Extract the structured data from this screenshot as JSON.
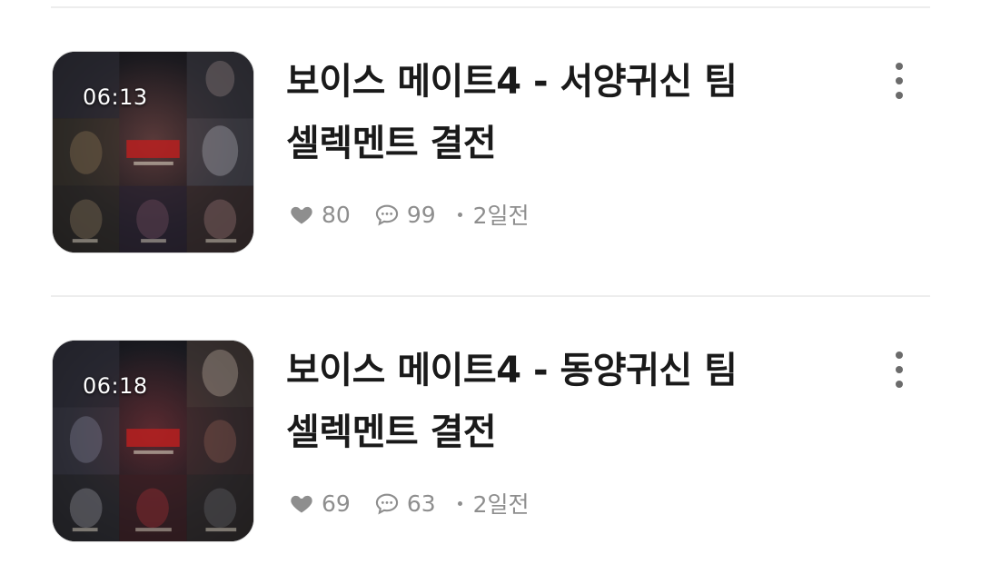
{
  "videos": [
    {
      "duration": "06:13",
      "title_line1": "보이스 메이트4 - 서양귀신 팀",
      "title_line2": "셀렉멘트 결전",
      "likes": "80",
      "comments": "99",
      "time_ago": "2일전",
      "thumbnail_icon": "video-thumbnail"
    },
    {
      "duration": "06:18",
      "title_line1": "보이스 메이트4 - 동양귀신 팀",
      "title_line2": "셀렉멘트 결전",
      "likes": "69",
      "comments": "63",
      "time_ago": "2일전",
      "thumbnail_icon": "video-thumbnail"
    }
  ],
  "icons": {
    "like": "heart-icon",
    "comment": "comment-bubble-icon",
    "more": "more-vertical-icon"
  },
  "colors": {
    "title": "#1a1a1a",
    "meta": "#8e8e8e",
    "divider": "#ededed",
    "icon": "#8e8e8e"
  }
}
